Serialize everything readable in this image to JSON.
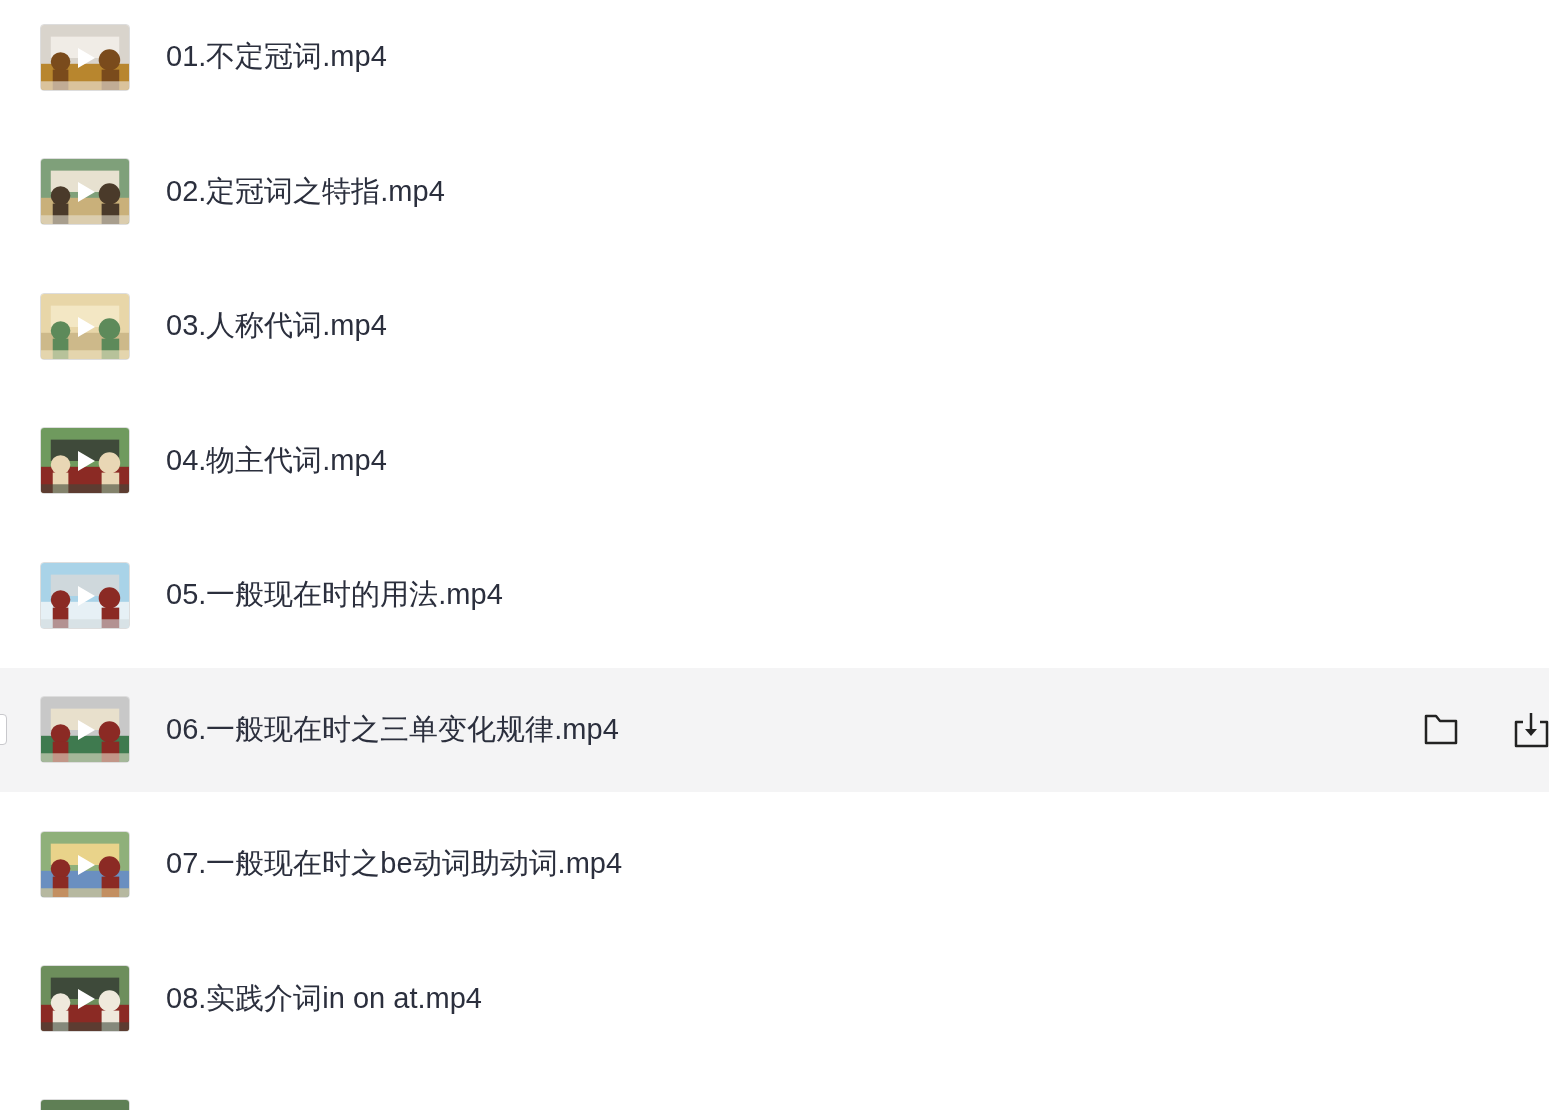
{
  "files": [
    {
      "name": "01.不定冠词.mp4",
      "hovered": false
    },
    {
      "name": "02.定冠词之特指.mp4",
      "hovered": false
    },
    {
      "name": "03.人称代词.mp4",
      "hovered": false
    },
    {
      "name": "04.物主代词.mp4",
      "hovered": false
    },
    {
      "name": "05.一般现在时的用法.mp4",
      "hovered": false
    },
    {
      "name": "06.一般现在时之三单变化规律.mp4",
      "hovered": true,
      "checked": false
    },
    {
      "name": "07.一般现在时之be动词助动词.mp4",
      "hovered": false
    },
    {
      "name": "08.实践介词in on at.mp4",
      "hovered": false
    },
    {
      "kind": "partial"
    }
  ]
}
